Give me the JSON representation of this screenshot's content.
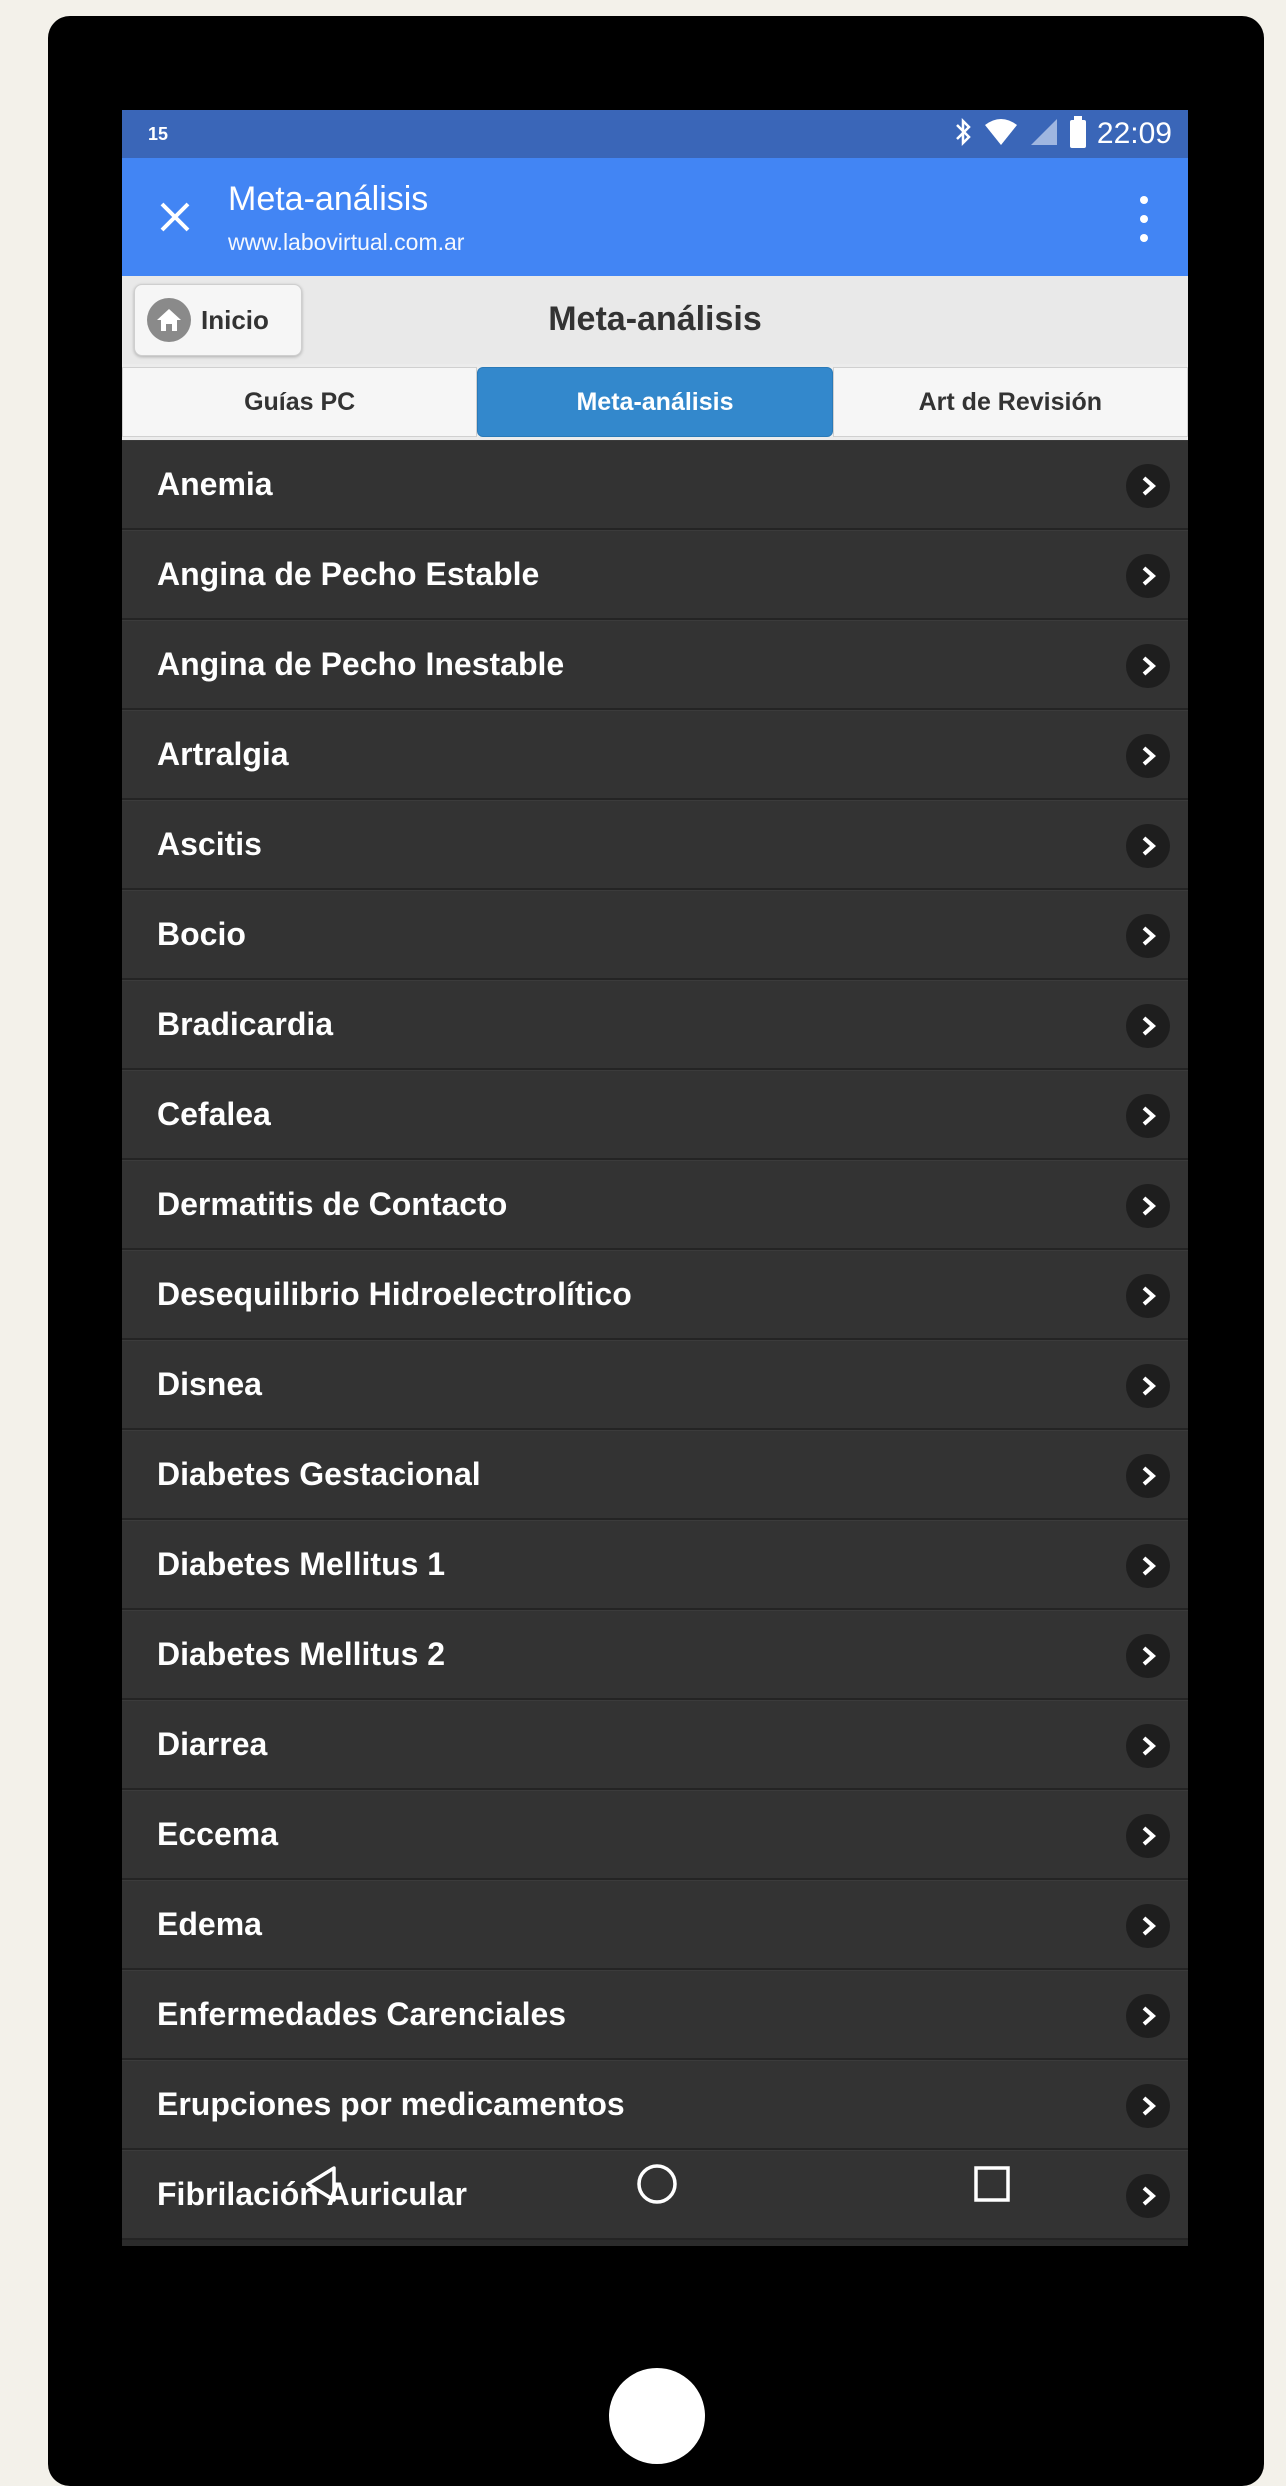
{
  "status_bar": {
    "left_text": "15",
    "time": "22:09",
    "icons": [
      "bluetooth-icon",
      "wifi-icon",
      "signal-icon",
      "battery-icon"
    ]
  },
  "chrome_bar": {
    "title": "Meta-análisis",
    "url": "www.labovirtual.com.ar",
    "close_icon": "close-icon",
    "menu_icon": "more-vert-icon"
  },
  "header": {
    "home_label": "Inicio",
    "home_icon": "home-icon",
    "title": "Meta-análisis"
  },
  "tabs": [
    {
      "label": "Guías PC",
      "active": false
    },
    {
      "label": "Meta-análisis",
      "active": true
    },
    {
      "label": "Art de Revisión",
      "active": false
    }
  ],
  "list": {
    "items": [
      "Anemia",
      "Angina de Pecho Estable",
      "Angina de Pecho Inestable",
      "Artralgia",
      "Ascitis",
      "Bocio",
      "Bradicardia",
      "Cefalea",
      "Dermatitis de Contacto",
      "Desequilibrio Hidroelectrolítico",
      "Disnea",
      "Diabetes Gestacional",
      "Diabetes Mellitus 1",
      "Diabetes Mellitus 2",
      "Diarrea",
      "Eccema",
      "Edema",
      "Enfermedades Carenciales",
      "Erupciones por medicamentos",
      "Fibrilación Auricular"
    ],
    "arrow_icon": "chevron-right-icon"
  },
  "colors": {
    "status_bar": "#3a66b8",
    "toolbar": "#4285f4",
    "active_tab": "#3388cc",
    "list_bg": "#333333"
  },
  "nav_bar": {
    "buttons": [
      "back-icon",
      "home-circle-icon",
      "recents-icon"
    ]
  }
}
